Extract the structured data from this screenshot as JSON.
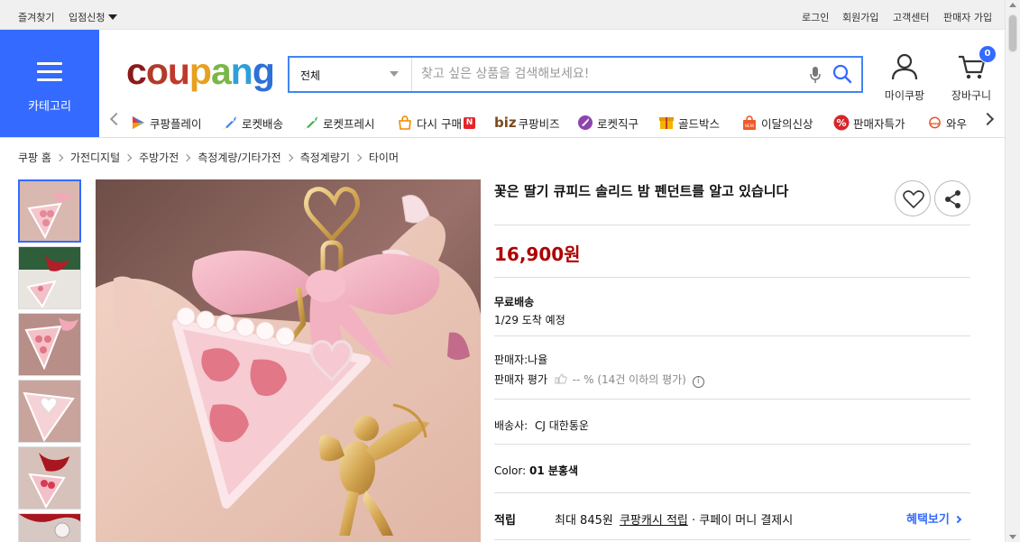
{
  "topbar": {
    "left": [
      "즐겨찾기",
      "입점신청"
    ],
    "right": [
      "로그인",
      "회원가입",
      "고객센터",
      "판매자 가입"
    ]
  },
  "header": {
    "category_label": "카테고리",
    "logo_text": [
      "c",
      "o",
      "u",
      "p",
      "a",
      "n",
      "g"
    ],
    "search_select": "전체",
    "search_placeholder": "찾고 싶은 상품을 검색해보세요!",
    "mycoupang_label": "마이쿠팡",
    "cart_label": "장바구니",
    "cart_count": "0"
  },
  "shortcuts": [
    {
      "label": "쿠팡플레이",
      "icon": "play-icon"
    },
    {
      "label": "로켓배송",
      "icon": "rocket-icon"
    },
    {
      "label": "로켓프레시",
      "icon": "rocket-fresh-icon"
    },
    {
      "label": "다시 구매",
      "icon": "rebuy-icon"
    },
    {
      "label": "쿠팡비즈",
      "icon": "biz-logo"
    },
    {
      "label": "로켓직구",
      "icon": "global-icon"
    },
    {
      "label": "골드박스",
      "icon": "goldbox-icon"
    },
    {
      "label": "이달의신상",
      "icon": "new-bag-icon"
    },
    {
      "label": "판매자특가",
      "icon": "percent-icon"
    },
    {
      "label": "와우",
      "icon": "wow-icon"
    }
  ],
  "shortcut_extra": {
    "biz_prefix": "biz",
    "new_badge": "N"
  },
  "breadcrumb": [
    "쿠팡 홈",
    "가전디지털",
    "주방가전",
    "측정계량/기타가전",
    "측정계량기",
    "타이머"
  ],
  "product": {
    "title": "꽃은 딸기 큐피드 솔리드 밤 펜던트를 알고 있습니다",
    "price": "16,900원",
    "shipping_title": "무료배송",
    "arrival": "1/29 도착 예정",
    "seller": "판매자:나율",
    "seller_rating_label": "판매자 평가",
    "seller_rating_value": "-- % (14건 이하의 평가)",
    "delivery_label": "배송사:",
    "delivery_company": "CJ 대한통운",
    "color_label": "Color:",
    "color_value": "01 분홍색",
    "reward_label": "적립",
    "reward_text_1": "최대 845원",
    "reward_link": "쿠팡캐시 적립",
    "reward_text_2": "· 쿠페이 머니 결제시",
    "benefit_link": "혜택보기"
  },
  "colors": {
    "brand_blue": "#346aff",
    "price_red": "#ae0000",
    "search_border": "#4285f4"
  }
}
